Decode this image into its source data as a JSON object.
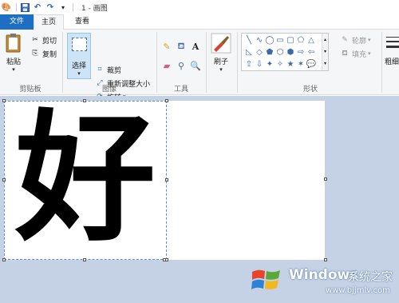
{
  "window": {
    "title": "1 - 画图"
  },
  "quick_access": [
    {
      "name": "paint-app-icon",
      "glyph": "🎨"
    },
    {
      "name": "save-icon",
      "glyph": "💾"
    },
    {
      "name": "undo-icon",
      "glyph": "↶"
    },
    {
      "name": "redo-icon",
      "glyph": "↷"
    },
    {
      "name": "customize-qa-icon",
      "glyph": "▾"
    }
  ],
  "tabs": [
    {
      "label": "文件",
      "active": false
    },
    {
      "label": "主页",
      "active": true
    },
    {
      "label": "查看",
      "active": false
    }
  ],
  "ribbon": {
    "clipboard": {
      "label": "剪贴板",
      "paste": "粘贴",
      "cut": "剪切",
      "copy": "复制"
    },
    "image": {
      "label": "图像",
      "select": "选择",
      "crop": "裁剪",
      "resize": "重新调整大小",
      "rotate": "旋转"
    },
    "tools": {
      "label": "工具"
    },
    "brushes": {
      "label": "刷子"
    },
    "shapes": {
      "label": "形状",
      "outline": "轮廓",
      "fill": "填充",
      "glyphs": [
        "╲",
        "∿",
        "◯",
        "▭",
        "▢",
        "⬠",
        "△",
        "◺",
        "◇",
        "⬟",
        "⬡",
        "⬢",
        "⇨",
        "⇦",
        "⇧",
        "⇩",
        "✦",
        "✧",
        "★",
        "✶",
        "💬",
        "🗨",
        "♡",
        "⚡"
      ]
    },
    "colors": {
      "label": "粗细"
    }
  },
  "canvas": {
    "glyph": "好"
  },
  "watermark": {
    "title": "Windows",
    "subtitle": "系统之家",
    "url": "www.bjjmlv.com"
  }
}
